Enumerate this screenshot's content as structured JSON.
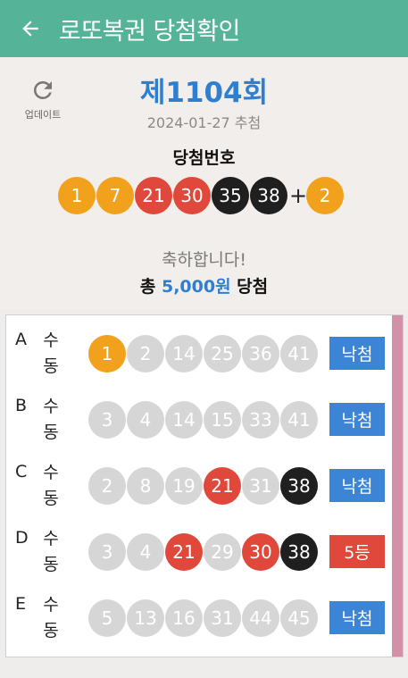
{
  "app": {
    "title": "로또복권 당첨확인"
  },
  "summary": {
    "refresh_label": "업데이트",
    "round": "제1104회",
    "draw_date": "2024-01-27 추첨",
    "win_label": "당첨번호",
    "numbers": [
      {
        "value": "1",
        "color": "#f2a11c"
      },
      {
        "value": "7",
        "color": "#f2a11c"
      },
      {
        "value": "21",
        "color": "#e0483b"
      },
      {
        "value": "30",
        "color": "#e0483b"
      },
      {
        "value": "35",
        "color": "#1f1f1f"
      },
      {
        "value": "38",
        "color": "#1f1f1f"
      }
    ],
    "plus": "+",
    "bonus": {
      "value": "2",
      "color": "#f2a11c"
    },
    "congrats": "축하합니다!",
    "total_prefix": "총 ",
    "total_amount": "5,000원",
    "total_suffix": " 당첨"
  },
  "ticket": {
    "rows": [
      {
        "letter": "A",
        "mode_top": "수",
        "mode_bottom": "동",
        "balls": [
          {
            "value": "1",
            "color": "#f2a11c"
          },
          {
            "value": "2",
            "color": "#d6d6d6"
          },
          {
            "value": "14",
            "color": "#d6d6d6"
          },
          {
            "value": "25",
            "color": "#d6d6d6"
          },
          {
            "value": "36",
            "color": "#d6d6d6"
          },
          {
            "value": "41",
            "color": "#d6d6d6"
          }
        ],
        "result": "낙첨",
        "result_color": "#3b84d6"
      },
      {
        "letter": "B",
        "mode_top": "수",
        "mode_bottom": "동",
        "balls": [
          {
            "value": "3",
            "color": "#d6d6d6"
          },
          {
            "value": "4",
            "color": "#d6d6d6"
          },
          {
            "value": "14",
            "color": "#d6d6d6"
          },
          {
            "value": "15",
            "color": "#d6d6d6"
          },
          {
            "value": "33",
            "color": "#d6d6d6"
          },
          {
            "value": "41",
            "color": "#d6d6d6"
          }
        ],
        "result": "낙첨",
        "result_color": "#3b84d6"
      },
      {
        "letter": "C",
        "mode_top": "수",
        "mode_bottom": "동",
        "balls": [
          {
            "value": "2",
            "color": "#d6d6d6"
          },
          {
            "value": "8",
            "color": "#d6d6d6"
          },
          {
            "value": "19",
            "color": "#d6d6d6"
          },
          {
            "value": "21",
            "color": "#e0483b"
          },
          {
            "value": "31",
            "color": "#d6d6d6"
          },
          {
            "value": "38",
            "color": "#1f1f1f"
          }
        ],
        "result": "낙첨",
        "result_color": "#3b84d6"
      },
      {
        "letter": "D",
        "mode_top": "수",
        "mode_bottom": "동",
        "balls": [
          {
            "value": "3",
            "color": "#d6d6d6"
          },
          {
            "value": "4",
            "color": "#d6d6d6"
          },
          {
            "value": "21",
            "color": "#e0483b"
          },
          {
            "value": "29",
            "color": "#d6d6d6"
          },
          {
            "value": "30",
            "color": "#e0483b"
          },
          {
            "value": "38",
            "color": "#1f1f1f"
          }
        ],
        "result": "5등",
        "result_color": "#e0483b"
      },
      {
        "letter": "E",
        "mode_top": "수",
        "mode_bottom": "동",
        "balls": [
          {
            "value": "5",
            "color": "#d6d6d6"
          },
          {
            "value": "13",
            "color": "#d6d6d6"
          },
          {
            "value": "16",
            "color": "#d6d6d6"
          },
          {
            "value": "31",
            "color": "#d6d6d6"
          },
          {
            "value": "44",
            "color": "#d6d6d6"
          },
          {
            "value": "45",
            "color": "#d6d6d6"
          }
        ],
        "result": "낙첨",
        "result_color": "#3b84d6"
      }
    ]
  },
  "colors": {
    "appbar": "#55b498",
    "accent": "#2f7fd0",
    "side_bar": "#d291a8"
  },
  "icons": {
    "back": "arrow-left-icon",
    "refresh": "refresh-icon"
  }
}
